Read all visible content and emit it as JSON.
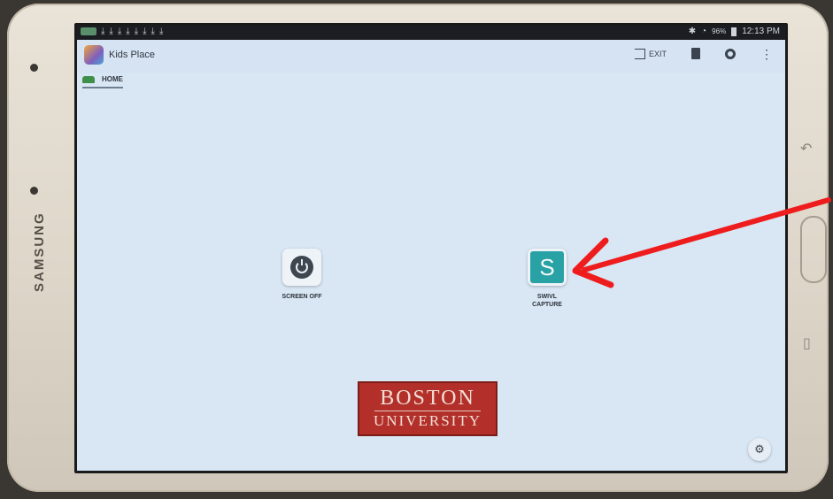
{
  "device": {
    "brand": "SAMSUNG"
  },
  "status_bar": {
    "time": "12:13 PM",
    "battery": "96%",
    "notification_icons": [
      "⤓",
      "⤓",
      "⤓",
      "⤓",
      "⤓",
      "⤓",
      "⤓",
      "⤓"
    ]
  },
  "app_bar": {
    "title": "Kids Place",
    "exit_label": "EXIT"
  },
  "tabs": [
    {
      "label": "HOME"
    }
  ],
  "apps": [
    {
      "label": "SCREEN OFF",
      "icon": "power-icon"
    },
    {
      "label_line1": "SWIVL",
      "label_line2": "CAPTURE",
      "icon": "swivl-s-icon",
      "icon_letter": "S"
    }
  ],
  "logo": {
    "line1": "BOSTON",
    "line2": "UNIVERSITY"
  },
  "annotation": {
    "arrow_color": "#ee1c1c"
  },
  "colors": {
    "screen_bg": "#d9e6f4",
    "swivl_teal": "#29a2a5",
    "bu_red": "#b3302a"
  }
}
